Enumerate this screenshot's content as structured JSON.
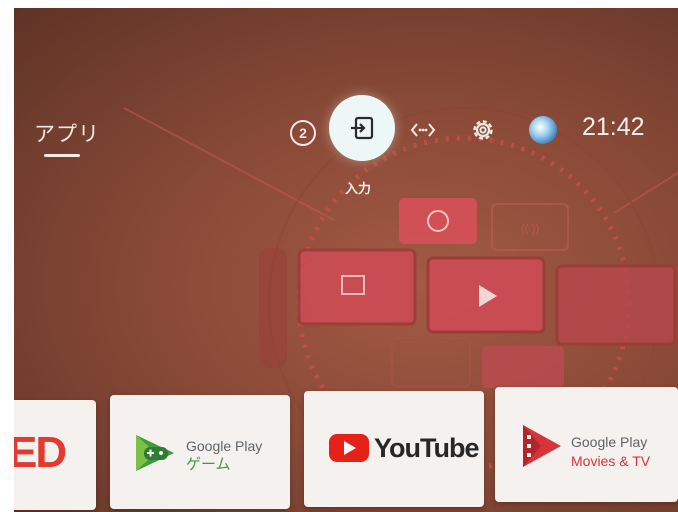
{
  "top_bar": {
    "apps_tab_label": "アプリ",
    "notification_count": "2",
    "input_label": "入力",
    "clock": "21:42",
    "icons": [
      "input-icon",
      "network-icon",
      "gear-icon",
      "avatar"
    ]
  },
  "apps_row": [
    {
      "name": "partial-app",
      "visible_text": "ED"
    },
    {
      "name": "google-play-games",
      "brand": "Google Play",
      "subtitle": "ゲーム"
    },
    {
      "name": "youtube",
      "title": "YouTube"
    },
    {
      "name": "google-play-movies",
      "brand": "Google Play",
      "subtitle": "Movies & TV"
    }
  ],
  "colors": {
    "accent_red": "#d6343a",
    "play_games_green": "#3f9b3c",
    "input_button_bg": "#eef7f7"
  }
}
